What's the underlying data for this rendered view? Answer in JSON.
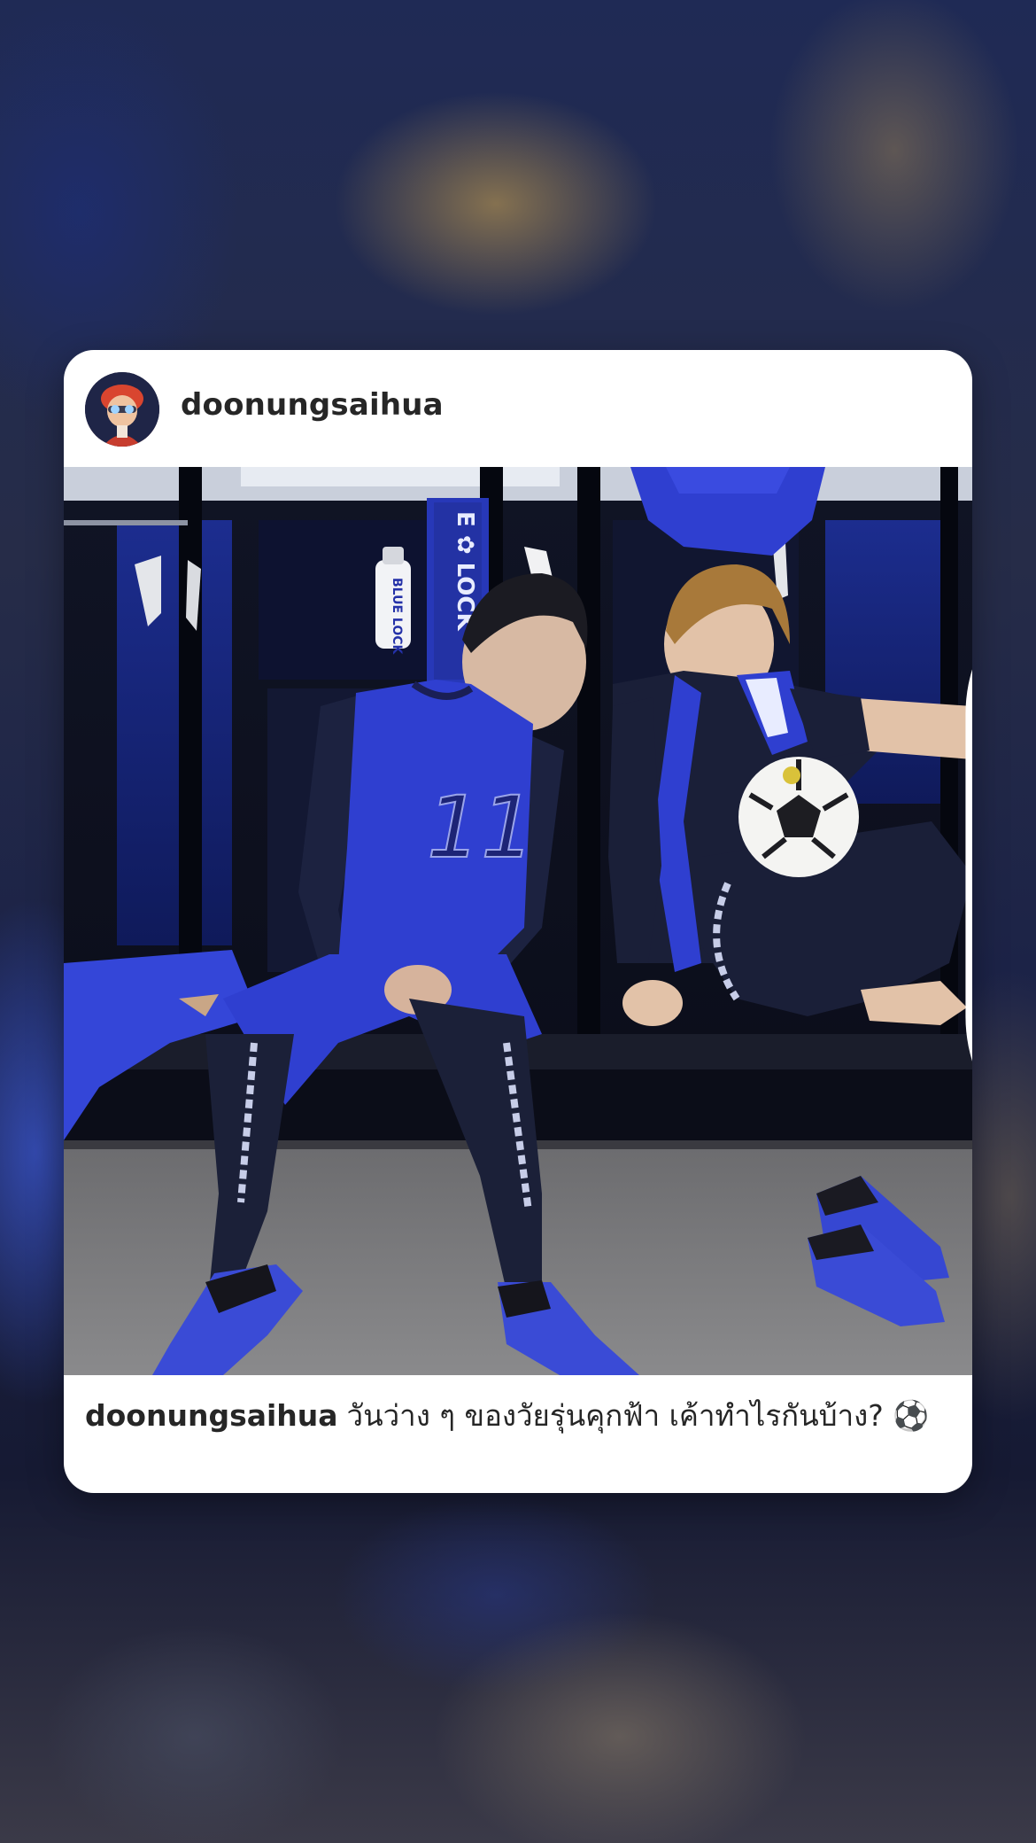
{
  "post": {
    "username": "doonungsaihua",
    "caption_username": "doonungsaihua",
    "caption_text": "วันว่าง ๆ ของวัยรุ่นคุกฟ้า เค้าทำไรกันบ้าง? ⚽",
    "media_type_icon": "multiple-photos-icon",
    "photo_text": {
      "scarf_text": "E ✿ LOCK",
      "bottle_text": "BLUE LOCK",
      "jersey_number": "11"
    }
  },
  "colors": {
    "card_background": "#ffffff",
    "text_primary": "#262626",
    "jersey_blue": "#2f3fd0"
  }
}
